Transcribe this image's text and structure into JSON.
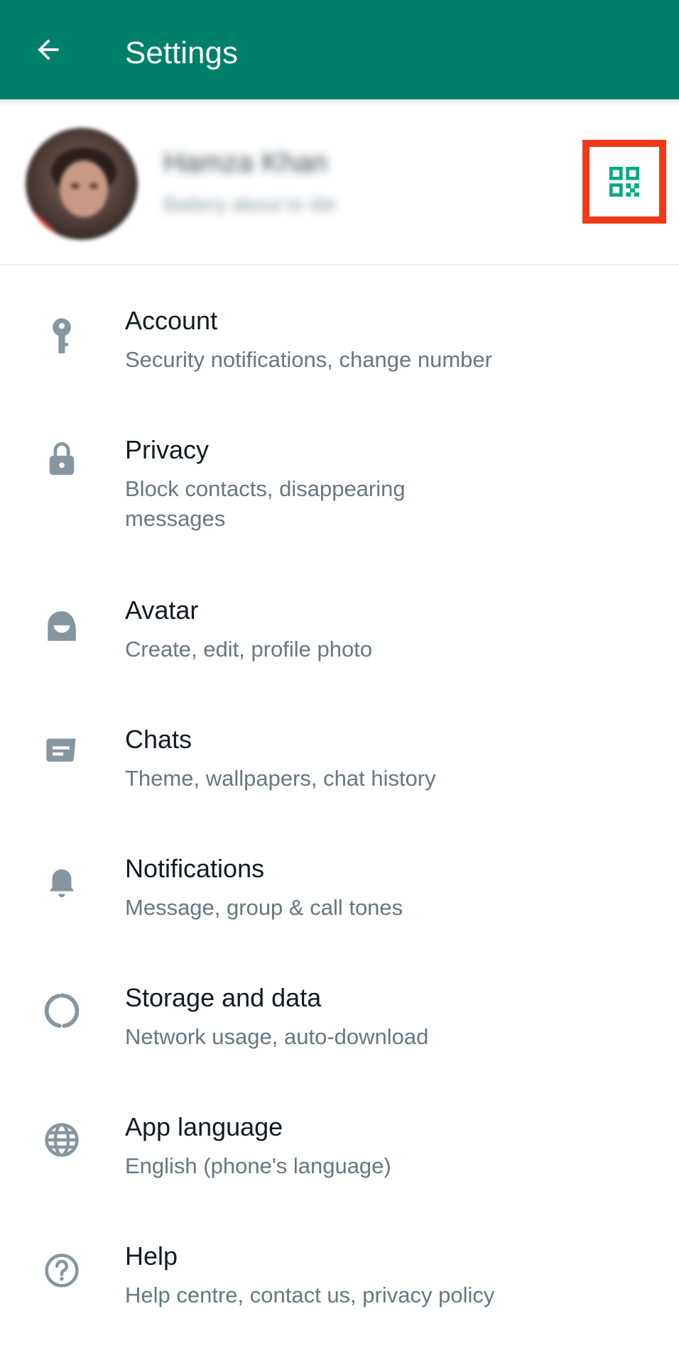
{
  "app_bar": {
    "title": "Settings",
    "back_icon": "arrow-left-icon",
    "background": "#008069"
  },
  "profile": {
    "name": "Hamza Khan",
    "about": "Battery about to die",
    "qr_icon": "qr-code-icon",
    "highlight_color": "#f03a17"
  },
  "settings": {
    "items": [
      {
        "title": "Account",
        "subtitle": "Security notifications, change number",
        "icon": "key-icon"
      },
      {
        "title": "Privacy",
        "subtitle": "Block contacts, disappearing messages",
        "icon": "lock-icon"
      },
      {
        "title": "Avatar",
        "subtitle": "Create, edit, profile photo",
        "icon": "avatar-face-icon"
      },
      {
        "title": "Chats",
        "subtitle": "Theme, wallpapers, chat history",
        "icon": "chat-icon"
      },
      {
        "title": "Notifications",
        "subtitle": "Message, group & call tones",
        "icon": "bell-icon"
      },
      {
        "title": "Storage and data",
        "subtitle": "Network usage, auto-download",
        "icon": "storage-circle-icon"
      },
      {
        "title": "App language",
        "subtitle": "English (phone's language)",
        "icon": "globe-icon"
      },
      {
        "title": "Help",
        "subtitle": "Help centre, contact us, privacy policy",
        "icon": "help-circle-icon"
      }
    ]
  },
  "colors": {
    "accent": "#008069",
    "icon_gray": "#8696a0",
    "title_text": "#111b21",
    "subtitle_text": "#667781"
  }
}
